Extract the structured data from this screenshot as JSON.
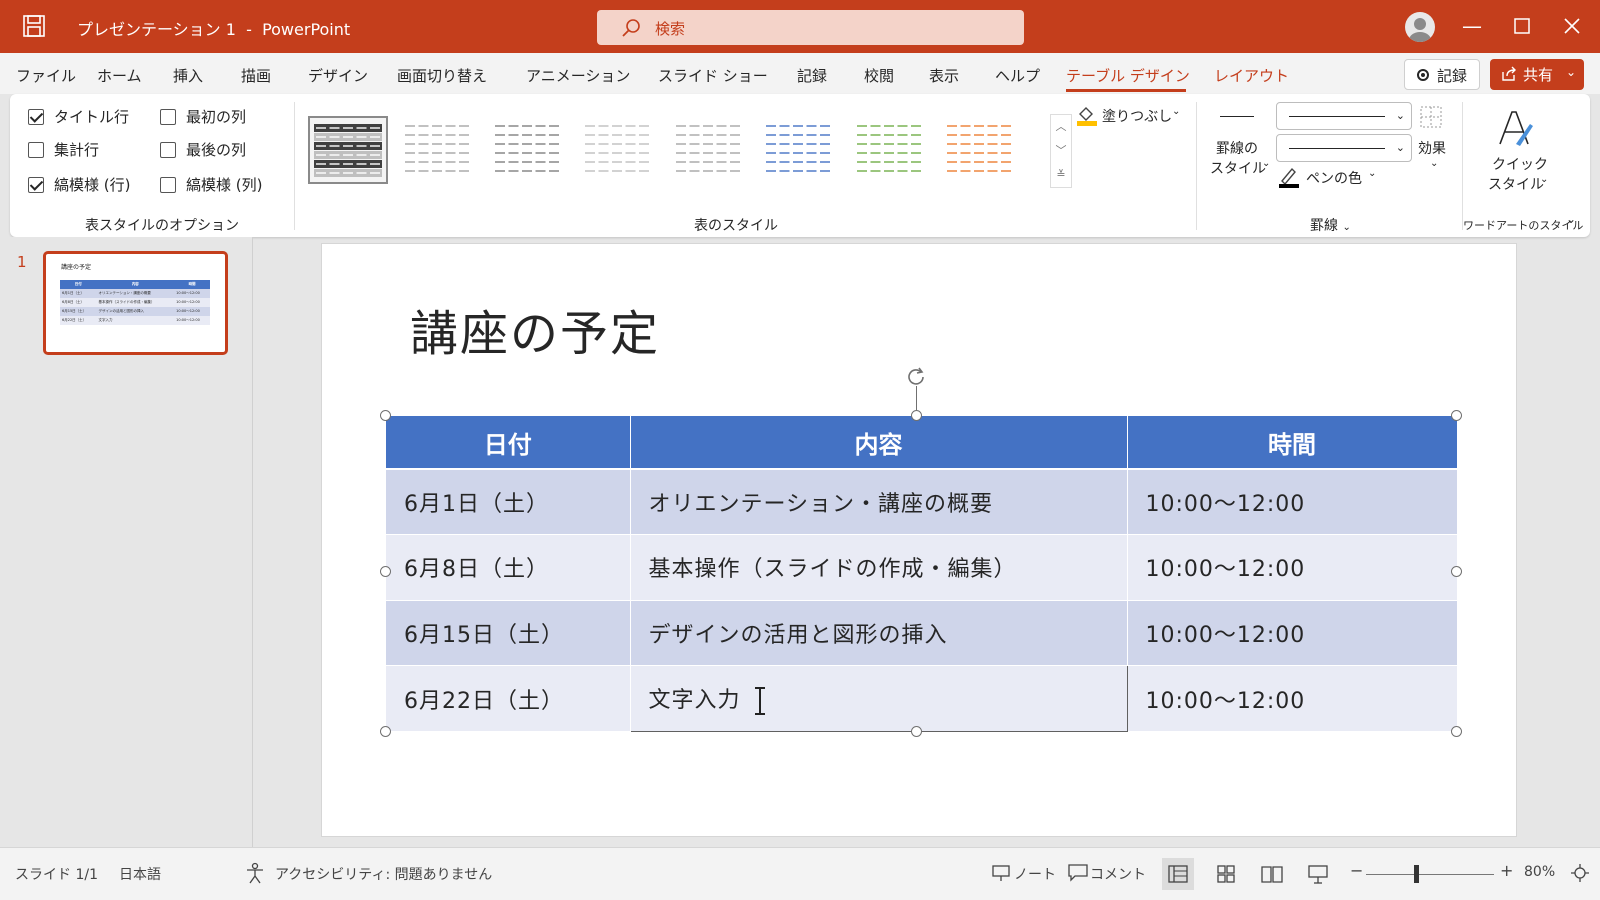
{
  "app": {
    "document_title": "プレゼンテーション 1  -  PowerPoint",
    "search_placeholder": "検索"
  },
  "menu": {
    "tabs": [
      "ファイル",
      "ホーム",
      "挿入",
      "描画",
      "デザイン",
      "画面切り替え",
      "アニメーション",
      "スライド ショー",
      "記録",
      "校閲",
      "表示",
      "ヘルプ"
    ],
    "contextual_tabs": [
      "テーブル デザイン",
      "レイアウト"
    ],
    "active_tab": "テーブル デザイン",
    "record_label": "記録",
    "share_label": "共有"
  },
  "ribbon": {
    "style_options": {
      "header_row": {
        "label": "タイトル行",
        "checked": true
      },
      "total_row": {
        "label": "集計行",
        "checked": false
      },
      "banded_rows": {
        "label": "縞模様 (行)",
        "checked": true
      },
      "first_column": {
        "label": "最初の列",
        "checked": false
      },
      "last_column": {
        "label": "最後の列",
        "checked": false
      },
      "banded_columns": {
        "label": "縞模様 (列)",
        "checked": false
      },
      "group_label": "表スタイルのオプション"
    },
    "table_styles": {
      "group_label": "表のスタイル",
      "accent_colors": [
        "#404040",
        "#a6a6a6",
        "#808080",
        "#bfbfbf",
        "#a6a6a6",
        "#4472c4",
        "#70ad47",
        "#ed7d31"
      ],
      "shading_label": "塗りつぶし"
    },
    "borders": {
      "border_style_label_line1": "罫線の",
      "border_style_label_line2": "スタイル",
      "pen_color_label": "ペンの色",
      "effects_label": "効果",
      "group_label": "罫線"
    },
    "wordart": {
      "quick_style_line1": "クイック",
      "quick_style_line2": "スタイル",
      "group_label": "ワードアートのスタイル"
    }
  },
  "thumbnails": [
    {
      "number": "1",
      "title": "講座の予定"
    }
  ],
  "slide": {
    "title": "講座の予定",
    "table": {
      "headers": [
        "日付",
        "内容",
        "時間"
      ],
      "rows": [
        [
          "6月1日（土）",
          "オリエンテーション・講座の概要",
          "10:00～12:00"
        ],
        [
          "6月8日（土）",
          "基本操作（スライドの作成・編集）",
          "10:00～12:00"
        ],
        [
          "6月15日（土）",
          "デザインの活用と図形の挿入",
          "10:00～12:00"
        ],
        [
          "6月22日（土）",
          "文字入力",
          "10:00～12:00"
        ]
      ]
    }
  },
  "status": {
    "slide_counter": "スライド 1/1",
    "language": "日本語",
    "accessibility": "アクセシビリティ: 問題ありません",
    "notes_label": "ノート",
    "comments_label": "コメント",
    "zoom_minus": "−",
    "zoom_plus": "+",
    "zoom_level": "80%"
  },
  "colors": {
    "accent": "#c43e1c",
    "table_header": "#4472c4",
    "band_dark": "#cfd5ea",
    "band_light": "#e9ebf5"
  }
}
